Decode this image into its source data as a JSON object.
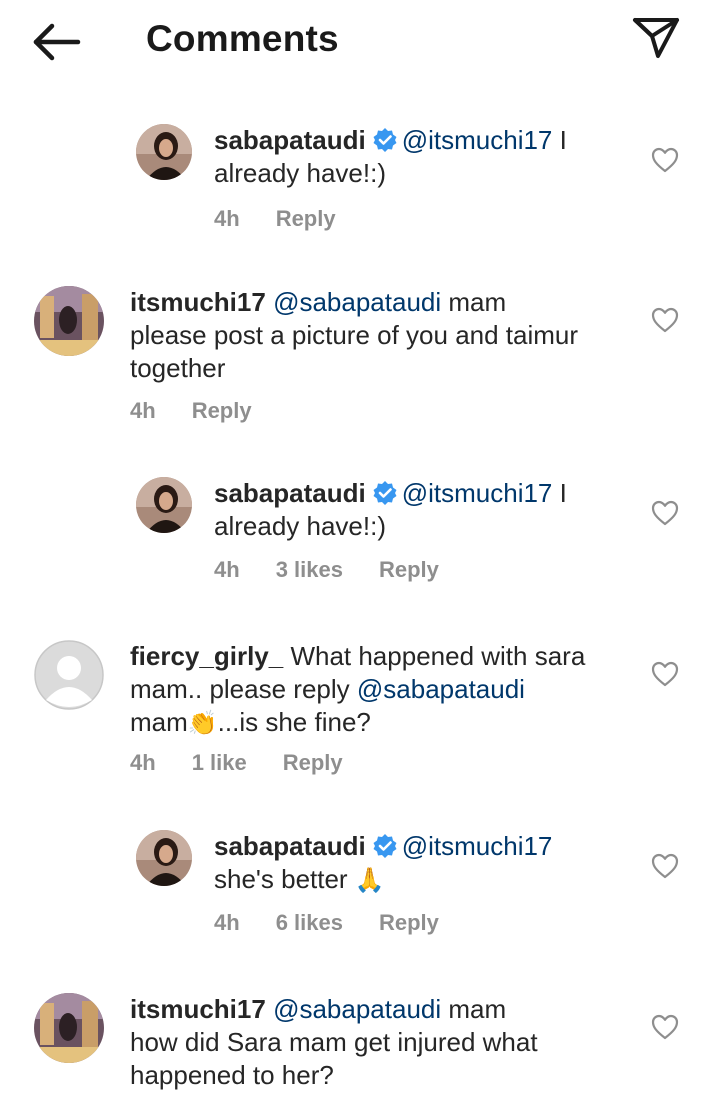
{
  "header": {
    "title": "Comments"
  },
  "comments": [
    {
      "username": "sabapataudi",
      "mention": "@itsmuchi17",
      "text_line1_tail": " I",
      "text_line2": "already have!:)",
      "time": "4h",
      "likes": "",
      "reply": "Reply"
    },
    {
      "username": "itsmuchi17",
      "mention": "@sabapataudi",
      "text_line1_tail": " mam",
      "text_line2": "please post a picture of you and taimur",
      "text_line3": "together",
      "time": "4h",
      "reply": "Reply"
    },
    {
      "username": "sabapataudi",
      "mention": "@itsmuchi17",
      "text_line1_tail": " I",
      "text_line2": "already have!:)",
      "time": "4h",
      "likes": "3 likes",
      "reply": "Reply"
    },
    {
      "username": "fiercy_girly_",
      "text_line1_tail": " What happened with sara",
      "text_line2_head": "mam.. please reply ",
      "mention": "@sabapataudi",
      "text_line3_head": "mam",
      "text_line3_emoji": "👏",
      "text_line3_tail": "...is she fine?",
      "time": "4h",
      "likes": "1 like",
      "reply": "Reply"
    },
    {
      "username": "sabapataudi",
      "mention": "@itsmuchi17",
      "text_line2": "she's better ",
      "text_line2_emoji": "🙏",
      "time": "4h",
      "likes": "6 likes",
      "reply": "Reply"
    },
    {
      "username": "itsmuchi17",
      "mention": "@sabapataudi",
      "text_line1_tail": " mam",
      "text_line2": "how did Sara mam get injured what",
      "text_line3": "happened to her?"
    }
  ],
  "colors": {
    "mention": "#00376b",
    "meta": "#8e8e8e",
    "verified": "#3897f0",
    "text": "#262626"
  },
  "icons": {
    "back": "arrow-left-icon",
    "send": "paper-plane-icon",
    "like": "heart-outline-icon",
    "verified": "verified-badge-icon"
  }
}
